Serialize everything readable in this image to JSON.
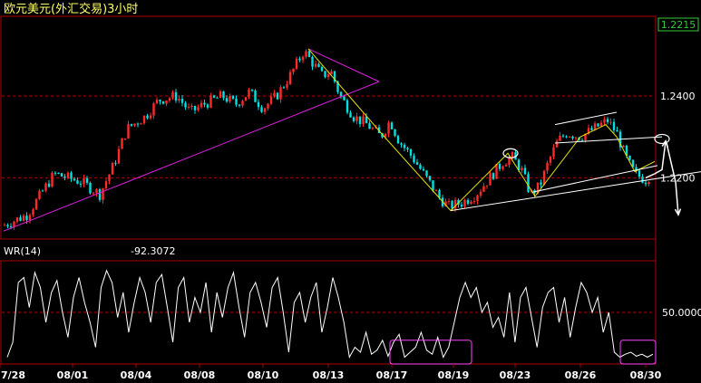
{
  "title": "欧元美元(外汇交易)3小时",
  "last_price_label": "1.2215",
  "indicator": {
    "name": "WR(14)",
    "value": "-92.3072",
    "mid_label": "50.0000"
  },
  "colors": {
    "background": "#000000",
    "frame": "#b00000",
    "up_candle": "#ff2a2a",
    "down_candle": "#00e0e0",
    "trendline_magenta": "#e020e0",
    "trendline_yellow": "#e6e600",
    "trendline_white": "#ffffff",
    "title_text": "#ffff66",
    "price_label": "#33cc33",
    "axis_text": "#ffffff",
    "highlight_box": "#ff44ff"
  },
  "chart_data": [
    {
      "type": "candlestick",
      "title": "欧元美元(外汇交易)3小时",
      "x_tick_labels": [
        "7/28",
        "08/01",
        "08/04",
        "08/08",
        "08/10",
        "08/13",
        "08/17",
        "08/19",
        "08/23",
        "08/26",
        "08/30"
      ],
      "y_tick_labels": [
        "1.2400",
        "1.2200"
      ],
      "last_price": 1.2215,
      "ylim": [
        1.2055,
        1.259
      ],
      "price_path": [
        [
          0,
          1.208
        ],
        [
          30,
          1.211
        ],
        [
          60,
          1.221
        ],
        [
          90,
          1.219
        ],
        [
          110,
          1.216
        ],
        [
          125,
          1.223
        ],
        [
          140,
          1.232
        ],
        [
          160,
          1.235
        ],
        [
          175,
          1.239
        ],
        [
          195,
          1.24
        ],
        [
          210,
          1.236
        ],
        [
          225,
          1.238
        ],
        [
          245,
          1.24
        ],
        [
          260,
          1.238
        ],
        [
          275,
          1.241
        ],
        [
          290,
          1.237
        ],
        [
          305,
          1.24
        ],
        [
          320,
          1.245
        ],
        [
          335,
          1.251
        ],
        [
          345,
          1.248
        ],
        [
          355,
          1.245
        ],
        [
          365,
          1.246
        ],
        [
          375,
          1.24
        ],
        [
          390,
          1.235
        ],
        [
          405,
          1.233
        ],
        [
          420,
          1.23
        ],
        [
          430,
          1.234
        ],
        [
          440,
          1.229
        ],
        [
          455,
          1.225
        ],
        [
          470,
          1.22
        ],
        [
          485,
          1.215
        ],
        [
          495,
          1.213
        ],
        [
          510,
          1.214
        ],
        [
          525,
          1.216
        ],
        [
          540,
          1.22
        ],
        [
          555,
          1.224
        ],
        [
          565,
          1.225
        ],
        [
          575,
          1.222
        ],
        [
          585,
          1.216
        ],
        [
          595,
          1.218
        ],
        [
          605,
          1.224
        ],
        [
          615,
          1.229
        ],
        [
          625,
          1.231
        ],
        [
          640,
          1.23
        ],
        [
          655,
          1.232
        ],
        [
          670,
          1.234
        ],
        [
          680,
          1.231
        ],
        [
          690,
          1.225
        ],
        [
          700,
          1.221
        ],
        [
          712,
          1.2195
        ],
        [
          720,
          1.2215
        ]
      ],
      "trend_lines": [
        {
          "color": "magenta",
          "points": [
            [
              4,
              1.207
            ],
            [
              418,
              1.2435
            ]
          ]
        },
        {
          "color": "magenta",
          "points": [
            [
              340,
              1.2515
            ],
            [
              418,
              1.2435
            ]
          ]
        },
        {
          "color": "yellow",
          "points": [
            [
              340,
              1.2515
            ],
            [
              420,
              1.231
            ],
            [
              497,
              1.212
            ],
            [
              560,
              1.226
            ],
            [
              590,
              1.2155
            ],
            [
              640,
              1.23
            ],
            [
              668,
              1.233
            ],
            [
              680,
              1.23
            ],
            [
              700,
              1.2215
            ],
            [
              722,
              1.224
            ]
          ]
        },
        {
          "color": "white",
          "points": [
            [
              497,
              1.212
            ],
            [
              773,
              1.2215
            ]
          ]
        },
        {
          "color": "white",
          "points": [
            [
              587,
              1.2165
            ],
            [
              725,
              1.223
            ]
          ]
        },
        {
          "color": "white",
          "points": [
            [
              612,
              1.233
            ],
            [
              680,
              1.236
            ]
          ]
        },
        {
          "color": "white",
          "points": [
            [
              612,
              1.2285
            ],
            [
              730,
              1.23
            ]
          ]
        }
      ],
      "projection_arrows": [
        {
          "points": [
            [
              712,
              1.22
            ],
            [
              722,
              1.221
            ],
            [
              730,
              1.222
            ],
            [
              734,
              1.229
            ]
          ]
        },
        {
          "points": [
            [
              735,
              1.2285
            ],
            [
              745,
              1.219
            ],
            [
              748,
              1.211
            ]
          ]
        }
      ],
      "wedge_markers": [
        {
          "x": 563,
          "y": 1.226
        },
        {
          "x": 730,
          "y": 1.2295
        }
      ]
    },
    {
      "type": "line",
      "title": "WR(14)",
      "current_value": -92.3072,
      "y_tick_labels": [
        "50.0000"
      ],
      "ylim": [
        -100,
        0
      ],
      "series": [
        {
          "values": [
            -95,
            -80,
            -20,
            -15,
            -45,
            -10,
            -25,
            -60,
            -30,
            -18,
            -50,
            -75,
            -35,
            -15,
            -40,
            -60,
            -85,
            -25,
            -8,
            -20,
            -55,
            -30,
            -70,
            -40,
            -15,
            -30,
            -60,
            -20,
            -12,
            -45,
            -80,
            -25,
            -15,
            -60,
            -35,
            -50,
            -20,
            -70,
            -30,
            -55,
            -25,
            -10,
            -45,
            -75,
            -30,
            -20,
            -40,
            -65,
            -25,
            -15,
            -50,
            -90,
            -40,
            -30,
            -60,
            -35,
            -20,
            -70,
            -45,
            -15,
            -35,
            -60,
            -95,
            -85,
            -90,
            -70,
            -92,
            -88,
            -78,
            -94,
            -80,
            -72,
            -95,
            -90,
            -85,
            -70,
            -88,
            -92,
            -75,
            -95,
            -85,
            -60,
            -35,
            -20,
            -35,
            -25,
            -50,
            -40,
            -65,
            -55,
            -75,
            -30,
            -80,
            -35,
            -25,
            -55,
            -85,
            -45,
            -30,
            -25,
            -60,
            -35,
            -75,
            -45,
            -20,
            -30,
            -50,
            -35,
            -70,
            -50,
            -90,
            -95,
            -92,
            -90,
            -94,
            -92,
            -95,
            -92
          ]
        }
      ],
      "highlight_boxes": [
        [
          430,
          520
        ],
        [
          684,
          723
        ]
      ]
    }
  ]
}
